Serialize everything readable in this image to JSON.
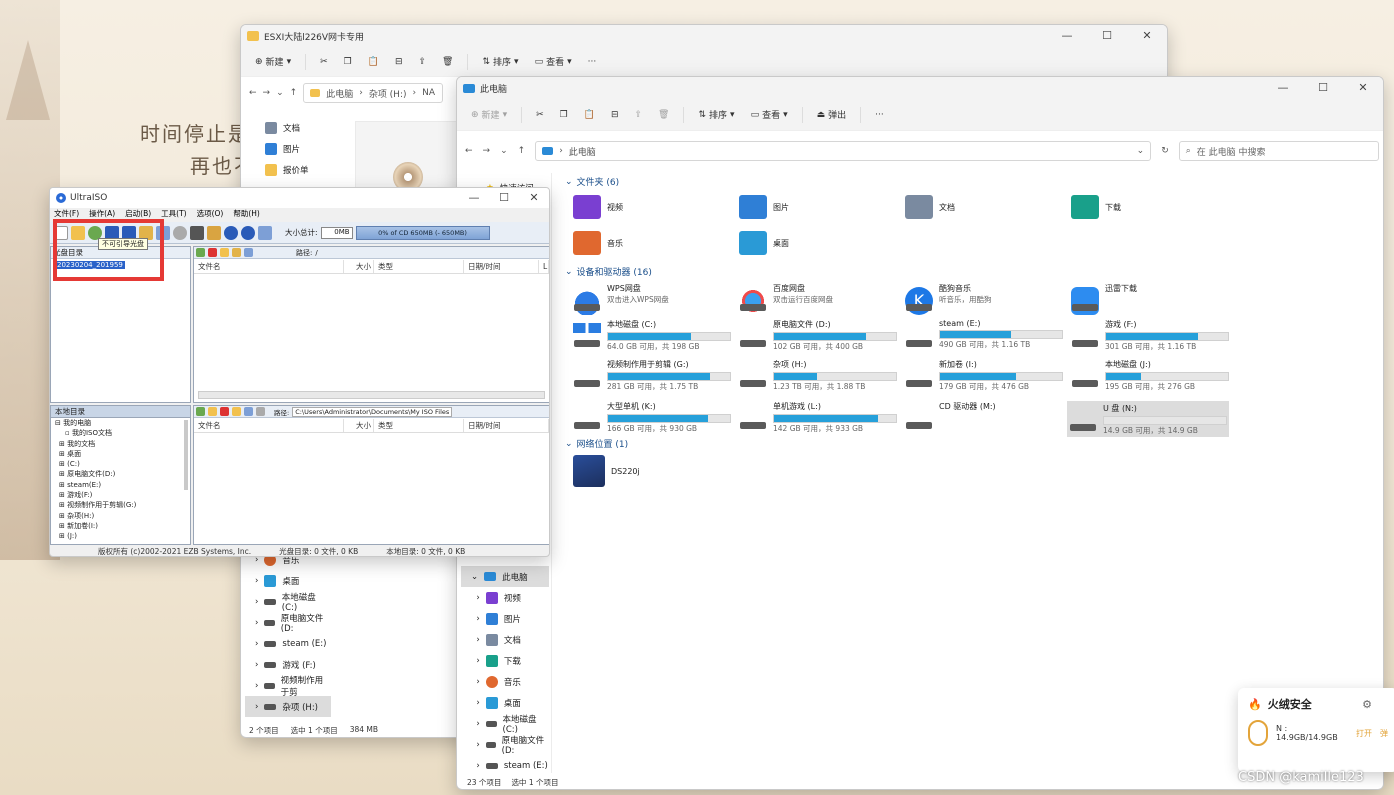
{
  "wallpaper": {
    "line1": "时间停止是",
    "line2": "再也不"
  },
  "back_explorer": {
    "title": "ESXI大陆l226V网卡专用",
    "toolbar": {
      "new": "新建",
      "sort": "排序",
      "view": "查看"
    },
    "path": [
      "此电脑",
      "杂项 (H:)",
      "NA"
    ],
    "quick": [
      "文档",
      "图片",
      "报价单"
    ],
    "nav_items": [
      "音乐",
      "桌面",
      "本地磁盘 (C:)",
      "原电脑文件 (D:",
      "steam (E:)",
      "游戏 (F:)",
      "视频制作用于剪",
      "杂项 (H:)"
    ],
    "status": {
      "items": "2 个项目",
      "selected": "选中 1 个项目",
      "size": "384 MB"
    }
  },
  "ultraiso": {
    "title": "UltraISO",
    "menu": [
      "文件(F)",
      "操作(A)",
      "启动(B)",
      "工具(T)",
      "选项(O)",
      "帮助(H)"
    ],
    "size_label": "大小总计:",
    "size_value": "0MB",
    "cd_label": "0% of CD 650MB (- 650MB)",
    "tooltip": "不可引导光盘",
    "disc_dir_label": "光盘目录",
    "volume_label": "20230204_201959",
    "path_label": "路径:",
    "top_path": "/",
    "local_path": "C:\\Users\\Administrator\\Documents\\My ISO Files",
    "col": {
      "name": "文件名",
      "size": "大小",
      "type": "类型",
      "date": "日期/时间",
      "extra": "L"
    },
    "local_dir_label": "本地目录",
    "local_tree": [
      "我的电脑",
      "我的ISO文档",
      "我的文档",
      "桌面",
      "(C:)",
      "原电脑文件(D:)",
      "steam(E:)",
      "游戏(F:)",
      "视频制作用于剪辑(G:)",
      "杂项(H:)",
      "新加卷(I:)",
      "(J:)"
    ],
    "status": {
      "copyright": "版权所有 (c)2002-2021 EZB Systems, Inc.",
      "disc": "光盘目录: 0 文件, 0 KB",
      "local": "本地目录: 0 文件, 0 KB"
    }
  },
  "front_explorer": {
    "title": "此电脑",
    "toolbar": {
      "new": "新建",
      "sort": "排序",
      "view": "查看",
      "eject": "弹出",
      "more": "···"
    },
    "breadcrumb": "此电脑",
    "search_placeholder": "在 此电脑 中搜索",
    "quick_access": "快速访问",
    "sections": {
      "folders": "文件夹 (6)",
      "drives": "设备和驱动器 (16)",
      "network": "网络位置 (1)"
    },
    "folders": [
      {
        "name": "视频",
        "color": "#7a3fd1"
      },
      {
        "name": "图片",
        "color": "#2f7fd6"
      },
      {
        "name": "文档",
        "color": "#7a8aa0"
      },
      {
        "name": "下载",
        "color": "#19a08a"
      },
      {
        "name": "音乐",
        "color": "#e0682f"
      },
      {
        "name": "桌面",
        "color": "#2a9ad6"
      }
    ],
    "apps": [
      {
        "name": "WPS网盘",
        "sub": "双击进入WPS网盘",
        "color": "#2c7be5"
      },
      {
        "name": "百度网盘",
        "sub": "双击运行百度网盘",
        "color": "#3aa0ef"
      },
      {
        "name": "酷狗音乐",
        "sub": "听音乐，用酷狗",
        "color": "#1d78e6"
      },
      {
        "name": "迅雷下载",
        "sub": "",
        "color": "#2d8cf0"
      }
    ],
    "drives": [
      {
        "name": "本地磁盘 (C:)",
        "free": "64.0 GB 可用，共 198 GB",
        "used": 0.68
      },
      {
        "name": "原电脑文件 (D:)",
        "free": "102 GB 可用，共 400 GB",
        "used": 0.75
      },
      {
        "name": "steam (E:)",
        "free": "490 GB 可用，共 1.16 TB",
        "used": 0.58
      },
      {
        "name": "游戏 (F:)",
        "free": "301 GB 可用，共 1.16 TB",
        "used": 0.75
      },
      {
        "name": "视频制作用于剪辑 (G:)",
        "free": "281 GB 可用，共 1.75 TB",
        "used": 0.84
      },
      {
        "name": "杂项 (H:)",
        "free": "1.23 TB 可用，共 1.88 TB",
        "used": 0.35
      },
      {
        "name": "新加卷 (I:)",
        "free": "179 GB 可用，共 476 GB",
        "used": 0.62
      },
      {
        "name": "本地磁盘 (J:)",
        "free": "195 GB 可用，共 276 GB",
        "used": 0.29
      },
      {
        "name": "大型单机 (K:)",
        "free": "166 GB 可用，共 930 GB",
        "used": 0.82
      },
      {
        "name": "单机游戏 (L:)",
        "free": "142 GB 可用，共 933 GB",
        "used": 0.85
      },
      {
        "name": "CD 驱动器 (M:)",
        "free": "",
        "used": null
      },
      {
        "name": "U 盘 (N:)",
        "free": "14.9 GB 可用，共 14.9 GB",
        "used": 0.0
      }
    ],
    "network": [
      {
        "name": "DS220j"
      }
    ],
    "nav_tree": [
      "此电脑",
      "视频",
      "图片",
      "文档",
      "下载",
      "音乐",
      "桌面",
      "本地磁盘 (C:)",
      "原电脑文件 (D:",
      "steam (E:)"
    ],
    "status": {
      "items": "23 个项目",
      "selected": "选中 1 个项目"
    }
  },
  "notification": {
    "app": "火绒安全",
    "drive": "N :",
    "capacity": "14.9GB/14.9GB",
    "open": "打开",
    "eject": "弹"
  },
  "watermark": "CSDN @kamille123",
  "highlight_color": "#e53935"
}
